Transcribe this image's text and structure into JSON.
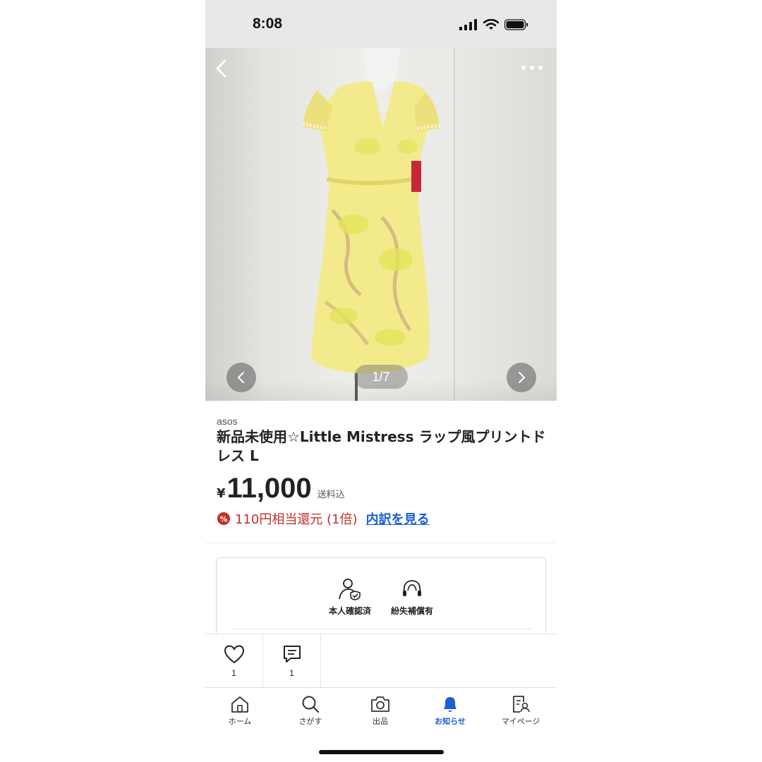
{
  "status_bar": {
    "time": "8:08"
  },
  "photo": {
    "counter": "1/7"
  },
  "item": {
    "brand": "asos",
    "title": "新品未使用☆Little Mistress ラップ風プリントドレス L",
    "currency": "¥",
    "price": "11,000",
    "shipping_note": "送料込",
    "points_text": "110円相当還元 (1倍)",
    "points_link": "内訳を見る"
  },
  "trust": {
    "verified_label": "本人確認済",
    "compensation_label": "紛失補償有"
  },
  "actions": {
    "like_count": "1",
    "comment_count": "1"
  },
  "tab_bar": {
    "items": [
      {
        "label": "ホーム",
        "icon": "home-icon"
      },
      {
        "label": "さがす",
        "icon": "search-icon"
      },
      {
        "label": "出品",
        "icon": "camera-icon"
      },
      {
        "label": "お知らせ",
        "icon": "bell-icon"
      },
      {
        "label": "マイページ",
        "icon": "mypage-icon"
      }
    ],
    "active": "お知らせ"
  },
  "colors": {
    "accent_blue": "#1a5fd4",
    "points_red": "#c0302b",
    "dress_yellow": "#f3ea8c"
  }
}
